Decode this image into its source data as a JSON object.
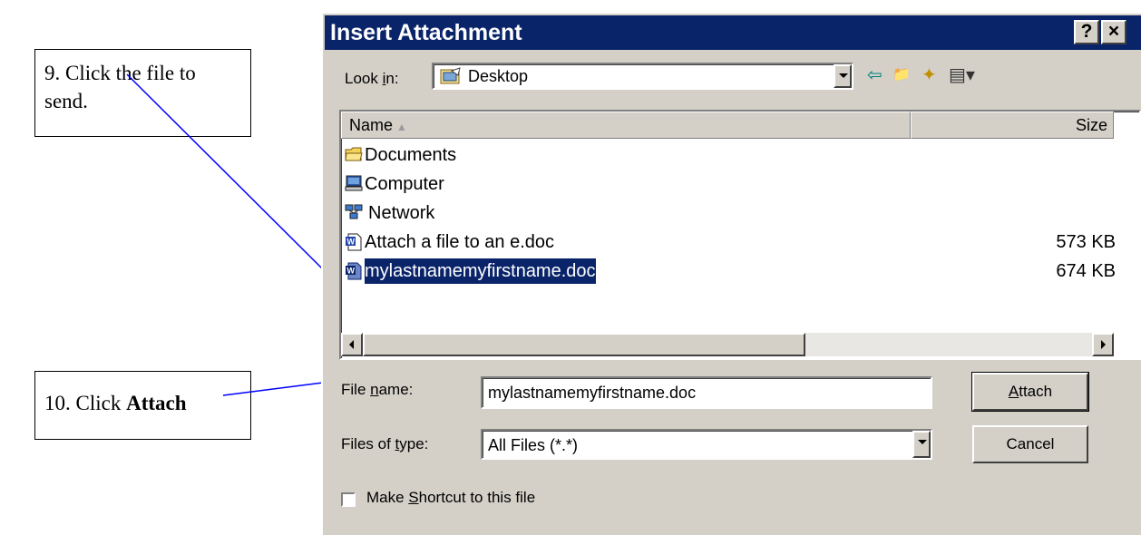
{
  "annotations": {
    "step9": "9. Click the file to send.",
    "step10_prefix": "10. Click ",
    "step10_bold": "Attach"
  },
  "dialog": {
    "title": "Insert Attachment",
    "help_button": "?",
    "close_button": "×",
    "look_in": {
      "label_prefix": "Look ",
      "label_underlined": "i",
      "label_suffix": "n:",
      "value": "Desktop"
    },
    "toolbar": {
      "back_icon": "⇦",
      "up_icon": "📁",
      "new_folder_icon": "✦",
      "views_icon": "▤▾"
    },
    "list": {
      "columns": [
        "Name",
        "Size"
      ],
      "sort_indicator": "▲",
      "items": [
        {
          "name": "Documents",
          "size": "",
          "icon": "folder-icon"
        },
        {
          "name": "Computer",
          "size": "",
          "icon": "computer-icon"
        },
        {
          "name": "Network",
          "size": "",
          "icon": "network-icon"
        },
        {
          "name": "Attach a file to an e.doc",
          "size": "573 KB",
          "icon": "word-doc-icon"
        },
        {
          "name": "mylastnamemyfirstname.doc",
          "size": "674 KB",
          "icon": "word-doc-icon",
          "selected": true
        }
      ]
    },
    "file_name": {
      "label_prefix": "File ",
      "label_underlined": "n",
      "label_suffix": "ame:",
      "value": "mylastnamemyfirstname.doc"
    },
    "files_of_type": {
      "label_prefix": "Files of ",
      "label_underlined": "t",
      "label_suffix": "ype:",
      "value": "All Files (*.*)"
    },
    "attach_button": {
      "underlined": "A",
      "rest": "ttach"
    },
    "cancel_button": "Cancel",
    "shortcut": {
      "label_prefix": "Make ",
      "label_underlined": "S",
      "label_suffix": "hortcut to this file",
      "checked": false
    },
    "colors": {
      "titlebar": "#0a246a",
      "face": "#d4d0c8",
      "selection": "#0a246a",
      "callout_line": "#0000ff"
    }
  }
}
